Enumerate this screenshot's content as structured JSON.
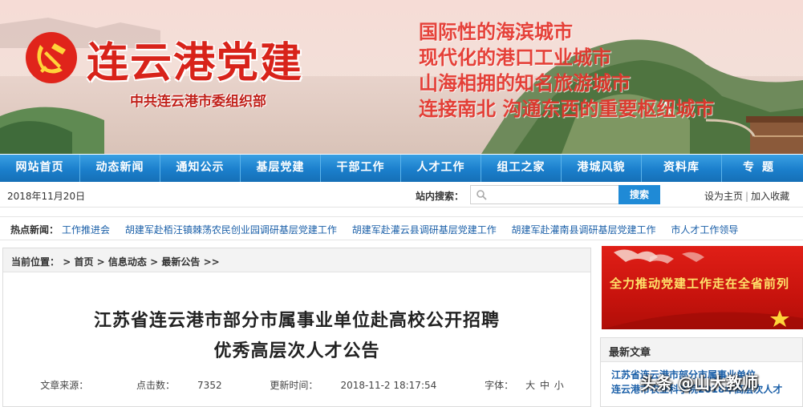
{
  "banner": {
    "title": "连云港党建",
    "subtitle": "中共连云港市委组织部",
    "slogans": [
      "国际性的海滨城市",
      "现代化的港口工业城市",
      "山海相拥的知名旅游城市",
      "连接南北 沟通东西的重要枢纽城市"
    ],
    "emblem_icon": "party-emblem-icon"
  },
  "nav": {
    "items": [
      "网站首页",
      "动态新闻",
      "通知公示",
      "基层党建",
      "干部工作",
      "人才工作",
      "组工之家",
      "港城风貌",
      "资料库",
      "专题"
    ]
  },
  "infobar": {
    "date": "2018年11月20日",
    "search_label": "站内搜索：",
    "search_value": "",
    "search_button": "搜索",
    "set_home": "设为主页",
    "separator": "|",
    "add_favorite": "加入收藏"
  },
  "hot": {
    "label": "热点新闻：",
    "items": [
      "工作推进会",
      "胡建军赴栢汪镇棘荡农民创业园调研基层党建工作",
      "胡建军赴灌云县调研基层党建工作",
      "胡建军赴灌南县调研基层党建工作",
      "市人才工作领导"
    ]
  },
  "breadcrumb": {
    "prefix": "当前位置：",
    "sep": ">",
    "items": [
      "首页",
      "信息动态",
      "最新公告"
    ],
    "end": ">>"
  },
  "article": {
    "title_line1": "江苏省连云港市部分市属事业单位赴高校公开招聘",
    "title_line2": "优秀高层次人才公告",
    "source_label": "文章来源：",
    "clicks_label": "点击数：",
    "clicks": "7352",
    "updated_label": "更新时间：",
    "updated": "2018-11-2 18:17:54",
    "font_label": "字体：",
    "font_sizes": [
      "大",
      "中",
      "小"
    ]
  },
  "promo": {
    "text": "全力推动党建工作走在全省前列"
  },
  "latest": {
    "header": "最新文章",
    "items": [
      "江苏省连云港市部分市属事业单位",
      "连云港市农业科学院2018年高层次人才"
    ]
  },
  "watermark": "头条 @山大教师",
  "colors": {
    "nav_blue": "#1b7fcc",
    "title_red": "#d8231a",
    "link_blue": "#1a5fa8",
    "promo_red": "#c8130d"
  }
}
